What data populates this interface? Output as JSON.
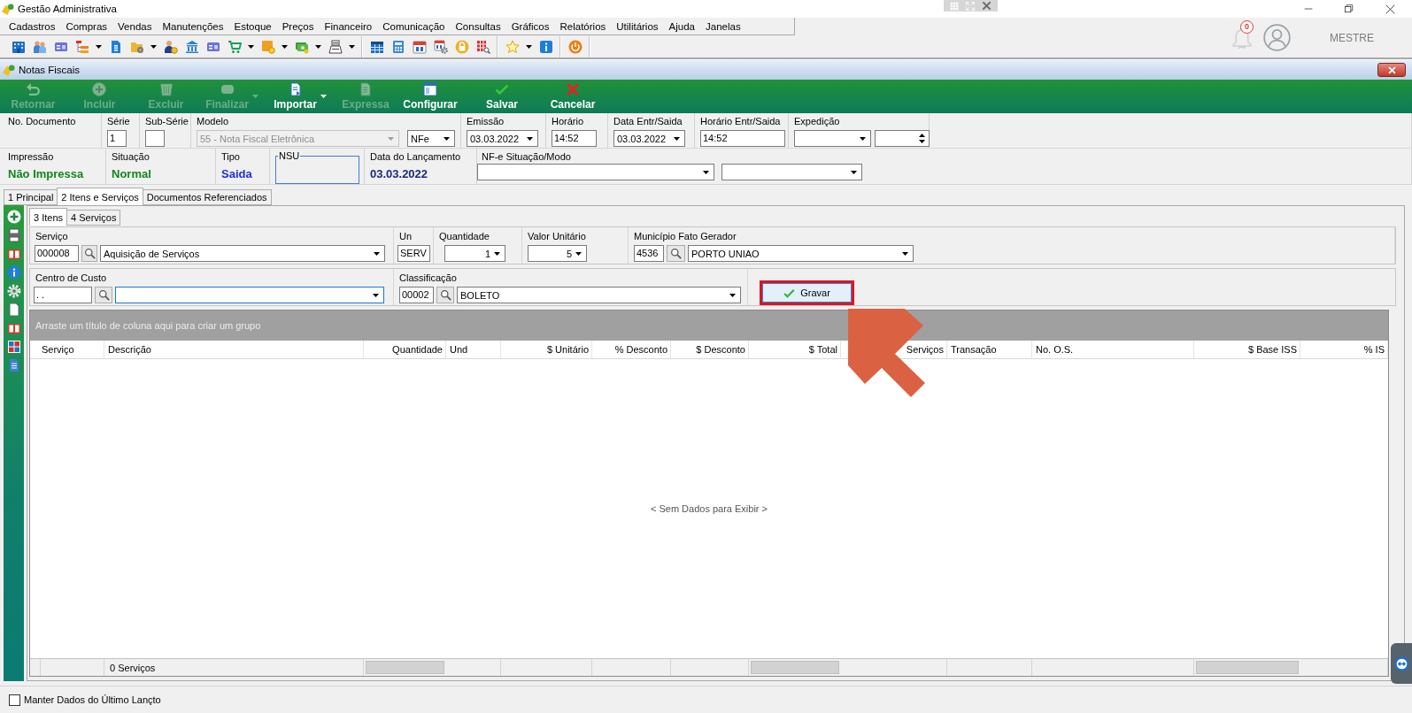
{
  "app_window": {
    "title": "Gestão Administrativa"
  },
  "menu": [
    "Cadastros",
    "Compras",
    "Vendas",
    "Manutenções",
    "Estoque",
    "Preços",
    "Financeiro",
    "Comunicação",
    "Consultas",
    "Gráficos",
    "Relatórios",
    "Utilitários",
    "Ajuda",
    "Janelas"
  ],
  "user_area": {
    "notification_count": "0",
    "user_name": "MESTRE"
  },
  "child_window": {
    "title": "Notas Fiscais"
  },
  "actions": [
    {
      "label": "Retornar",
      "disabled": true,
      "dropdown": false
    },
    {
      "label": "Incluir",
      "disabled": true,
      "dropdown": false
    },
    {
      "label": "Excluir",
      "disabled": true,
      "dropdown": false
    },
    {
      "label": "Finalizar",
      "disabled": true,
      "dropdown": true
    },
    {
      "label": "Importar",
      "disabled": false,
      "dropdown": true
    },
    {
      "label": "Expressa",
      "disabled": true,
      "dropdown": false
    },
    {
      "label": "Configurar",
      "disabled": false,
      "dropdown": false
    },
    {
      "label": "Salvar",
      "disabled": false,
      "dropdown": false
    },
    {
      "label": "Cancelar",
      "disabled": false,
      "dropdown": false
    }
  ],
  "document_fields": [
    {
      "label": "No. Documento"
    },
    {
      "label": "Série",
      "controls": [
        {
          "kind": "input",
          "value": "1"
        }
      ]
    },
    {
      "label": "Sub-Série",
      "controls": [
        {
          "kind": "input"
        }
      ]
    },
    {
      "label": "Modelo",
      "controls": [
        {
          "kind": "combo",
          "value": "55 - Nota Fiscal Eletrônica",
          "disabled": true
        },
        {
          "kind": "combo",
          "value": "NFe",
          "disabled": false
        }
      ]
    },
    {
      "label": "Emissão",
      "controls": [
        {
          "kind": "combo",
          "value": "03.03.2022",
          "disabled": false
        }
      ]
    },
    {
      "label": "Horário",
      "controls": [
        {
          "kind": "input",
          "value": "14:52"
        }
      ]
    },
    {
      "label": "Data Entr/Saida",
      "controls": [
        {
          "kind": "combo",
          "value": "03.03.2022",
          "disabled": false
        }
      ]
    },
    {
      "label": "Horário Entr/Saida",
      "controls": [
        {
          "kind": "input",
          "value": "14:52"
        }
      ]
    },
    {
      "label": "Expedição",
      "controls": [
        {
          "kind": "combo",
          "disabled": false
        },
        {
          "kind": "spinner"
        }
      ]
    }
  ],
  "status_fields": [
    {
      "kind": "value",
      "label": "Impressão",
      "value": "Não Impressa",
      "color": "#12861e"
    },
    {
      "kind": "value",
      "label": "Situação",
      "value": "Normal",
      "color": "#12861e"
    },
    {
      "kind": "value",
      "label": "Tipo",
      "value": "Saida",
      "color": "#1e2fd8"
    },
    {
      "kind": "group",
      "label": "NSU"
    },
    {
      "kind": "value",
      "label": "Data do Lançamento",
      "value": "03.03.2022",
      "color": "#1a2a80"
    },
    {
      "kind": "combos",
      "label": "NF-e Situação/Modo",
      "controls": [
        {
          "kind": "combo",
          "disabled": false
        },
        {
          "kind": "combo",
          "disabled": false
        }
      ]
    }
  ],
  "tabs": [
    {
      "label": "1 Principal",
      "selected": false
    },
    {
      "label": "2 Itens e Serviços",
      "selected": true
    },
    {
      "label": "Documentos Referenciados",
      "selected": false
    }
  ],
  "sub_tabs": [
    {
      "label": "3 Itens",
      "selected": true
    },
    {
      "label": "4 Serviços",
      "selected": false
    }
  ],
  "item_form": {
    "rows": [
      [
        {
          "label": "Serviço",
          "controls": [
            {
              "kind": "input",
              "value": "000008"
            },
            {
              "kind": "search"
            },
            {
              "kind": "combo",
              "value": "Aquisição de Serviços",
              "disabled": false,
              "focused": false
            }
          ]
        },
        {
          "label": "Un",
          "controls": [
            {
              "kind": "input",
              "value": "SERV"
            }
          ]
        },
        {
          "label": "Quantidade",
          "controls": [
            {
              "kind": "numeric_combo",
              "value": "1",
              "disabled": false,
              "focused": false
            }
          ]
        },
        {
          "label": "Valor Unitário",
          "controls": [
            {
              "kind": "numeric_combo",
              "value": "5",
              "disabled": false,
              "focused": false
            }
          ]
        },
        {
          "label": "Município Fato Gerador",
          "controls": [
            {
              "kind": "input",
              "value": "4536"
            },
            {
              "kind": "search"
            },
            {
              "kind": "combo",
              "value": "PORTO UNIAO",
              "disabled": false,
              "focused": false
            }
          ]
        }
      ],
      [
        {
          "label": "Centro de Custo",
          "controls": [
            {
              "kind": "input",
              "value": ". ."
            },
            {
              "kind": "search"
            },
            {
              "kind": "combo",
              "disabled": false,
              "focused": true
            }
          ]
        },
        {
          "label": "Classificação",
          "controls": [
            {
              "kind": "input",
              "value": "00002"
            },
            {
              "kind": "search"
            },
            {
              "kind": "combo",
              "value": "BOLETO",
              "disabled": false,
              "focused": false
            }
          ]
        }
      ]
    ],
    "save_button": {
      "label": "Gravar",
      "highlighted": true
    }
  },
  "grid": {
    "group_hint": "Arraste um título de coluna aqui para criar um grupo",
    "columns": [
      {
        "label": "Serviço",
        "numeric": false,
        "footer_total": false
      },
      {
        "label": "Descrição",
        "numeric": false,
        "footer_total": false,
        "footer_text": "0 Serviços"
      },
      {
        "label": "Quantidade",
        "numeric": true,
        "footer_total": true
      },
      {
        "label": "Und",
        "numeric": false,
        "footer_total": false
      },
      {
        "label": "$ Unitário",
        "numeric": true,
        "footer_total": false
      },
      {
        "label": "% Desconto",
        "numeric": true,
        "footer_total": false
      },
      {
        "label": "$ Desconto",
        "numeric": true,
        "footer_total": false
      },
      {
        "label": "$ Total",
        "numeric": true,
        "footer_total": true
      },
      {
        "label": "Serviços",
        "numeric": true,
        "footer_total": false
      },
      {
        "label": "Transação",
        "numeric": false,
        "footer_total": false
      },
      {
        "label": "No. O.S.",
        "numeric": false,
        "footer_total": false
      },
      {
        "label": "$ Base ISS",
        "numeric": true,
        "footer_total": true
      },
      {
        "label": "% IS",
        "numeric": true,
        "footer_total": false
      }
    ],
    "empty_text": "< Sem Dados para Exibir >"
  },
  "keep_data": {
    "label": "Manter Dados do Último Lançto",
    "checked": false
  },
  "callout_arrow": true
}
